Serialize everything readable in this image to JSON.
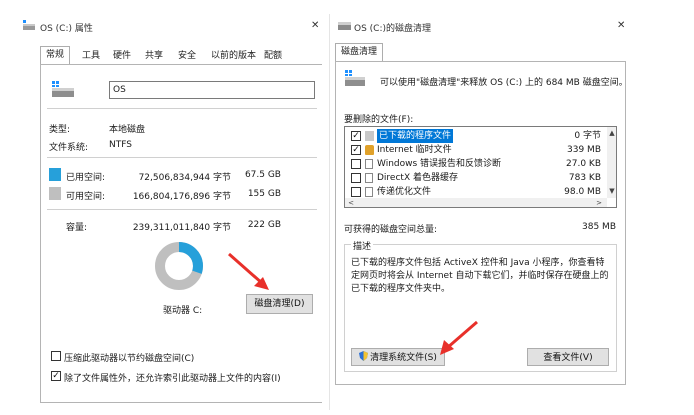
{
  "left_window": {
    "title": "OS (C:) 属性",
    "tabs": [
      "常规",
      "工具",
      "硬件",
      "共享",
      "安全",
      "以前的版本",
      "配额"
    ],
    "name_value": "OS",
    "type_label": "类型:",
    "type_value": "本地磁盘",
    "fs_label": "文件系统:",
    "fs_value": "NTFS",
    "used_label": "已用空间:",
    "used_bytes": "72,506,834,944 字节",
    "used_size": "67.5 GB",
    "free_label": "可用空间:",
    "free_bytes": "166,804,176,896 字节",
    "free_size": "155 GB",
    "capacity_label": "容量:",
    "capacity_bytes": "239,311,011,840 字节",
    "capacity_size": "222 GB",
    "drive_label": "驱动器 C:",
    "cleanup_button": "磁盘清理(D)",
    "compress_label": "压缩此驱动器以节约磁盘空间(C)",
    "index_label": "除了文件属性外，还允许索引此驱动器上文件的内容(I)",
    "used_fraction": 0.303,
    "colors": {
      "used": "#26a0da",
      "free": "#bfbfbf"
    }
  },
  "right_window": {
    "title": "OS (C:)的磁盘清理",
    "tab": "磁盘清理",
    "intro": "可以使用\"磁盘清理\"来释放 OS (C:) 上的 684 MB 磁盘空间。",
    "list_label": "要删除的文件(F):",
    "files": [
      {
        "name": "已下载的程序文件",
        "size": "0 字节",
        "checked": true,
        "selected": true
      },
      {
        "name": "Internet 临时文件",
        "size": "339 MB",
        "checked": true,
        "selected": false
      },
      {
        "name": "Windows 错误报告和反馈诊断",
        "size": "27.0 KB",
        "checked": false,
        "selected": false
      },
      {
        "name": "DirectX 着色器缓存",
        "size": "783 KB",
        "checked": false,
        "selected": false
      },
      {
        "name": "传递优化文件",
        "size": "98.0 MB",
        "checked": false,
        "selected": false
      }
    ],
    "total_label": "可获得的磁盘空间总量:",
    "total_value": "385 MB",
    "desc_title": "描述",
    "desc_text": "已下载的程序文件包括 ActiveX 控件和 Java 小程序，你查看特定网页时将会从 Internet 自动下载它们，并临时保存在硬盘上的已下载的程序文件夹中。",
    "clean_system_button": "清理系统文件(S)",
    "view_files_button": "查看文件(V)"
  },
  "glyphs": {
    "close": "✕",
    "check": "✓",
    "up": "▲",
    "down": "▼",
    "left": "<",
    "right": ">"
  }
}
